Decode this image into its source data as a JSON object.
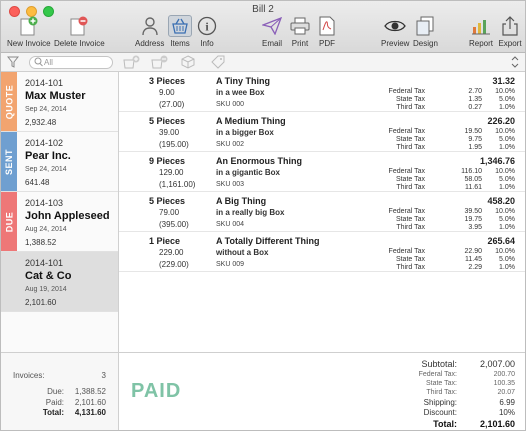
{
  "window": {
    "title": "Bill 2"
  },
  "toolbar": {
    "new_invoice": "New Invoice",
    "delete_invoice": "Delete Invoice",
    "address": "Address",
    "items": "Items",
    "info": "Info",
    "email": "Email",
    "print": "Print",
    "pdf": "PDF",
    "preview": "Preview",
    "design": "Design",
    "report": "Report",
    "export": "Export"
  },
  "search": {
    "placeholder": "All"
  },
  "invoices": [
    {
      "status": "QUOTE",
      "status_color": "#f2a46f",
      "number": "2014-101",
      "client": "Max Muster",
      "date": "Sep 24, 2014",
      "amount": "2,932.48"
    },
    {
      "status": "SENT",
      "status_color": "#6f9fd0",
      "number": "2014-102",
      "client": "Pear Inc.",
      "date": "Sep 24, 2014",
      "amount": "641.48"
    },
    {
      "status": "DUE",
      "status_color": "#ee7777",
      "number": "2014-103",
      "client": "John Appleseed",
      "date": "Aug 24, 2014",
      "amount": "1,388.52"
    },
    {
      "status": "",
      "status_color": "",
      "number": "2014-101",
      "client": "Cat & Co",
      "date": "Aug 19, 2014",
      "amount": "2,101.60"
    }
  ],
  "left_summary": {
    "invoices_label": "Invoices:",
    "invoices_value": "3",
    "due_label": "Due:",
    "due_value": "1,388.52",
    "paid_label": "Paid:",
    "paid_value": "2,101.60",
    "total_label": "Total:",
    "total_value": "4,131.60"
  },
  "items": [
    {
      "qty": "3 Pieces",
      "price": "9.00",
      "line_total": "(27.00)",
      "name": "A Tiny Thing",
      "desc": "in a wee Box",
      "sku": "SKU 000",
      "total": "31.32",
      "taxes": [
        {
          "label": "Federal Tax",
          "amount": "2.70",
          "rate": "10.0%"
        },
        {
          "label": "State Tax",
          "amount": "1.35",
          "rate": "5.0%"
        },
        {
          "label": "Third Tax",
          "amount": "0.27",
          "rate": "1.0%"
        }
      ]
    },
    {
      "qty": "5 Pieces",
      "price": "39.00",
      "line_total": "(195.00)",
      "name": "A Medium Thing",
      "desc": "in a bigger Box",
      "sku": "SKU 002",
      "total": "226.20",
      "taxes": [
        {
          "label": "Federal Tax",
          "amount": "19.50",
          "rate": "10.0%"
        },
        {
          "label": "State Tax",
          "amount": "9.75",
          "rate": "5.0%"
        },
        {
          "label": "Third Tax",
          "amount": "1.95",
          "rate": "1.0%"
        }
      ]
    },
    {
      "qty": "9 Pieces",
      "price": "129.00",
      "line_total": "(1,161.00)",
      "name": "An Enormous Thing",
      "desc": "in a gigantic Box",
      "sku": "SKU 003",
      "total": "1,346.76",
      "taxes": [
        {
          "label": "Federal Tax",
          "amount": "116.10",
          "rate": "10.0%"
        },
        {
          "label": "State Tax",
          "amount": "58.05",
          "rate": "5.0%"
        },
        {
          "label": "Third Tax",
          "amount": "11.61",
          "rate": "1.0%"
        }
      ]
    },
    {
      "qty": "5 Pieces",
      "price": "79.00",
      "line_total": "(395.00)",
      "name": "A Big Thing",
      "desc": "in a really big Box",
      "sku": "SKU 004",
      "total": "458.20",
      "taxes": [
        {
          "label": "Federal Tax",
          "amount": "39.50",
          "rate": "10.0%"
        },
        {
          "label": "State Tax",
          "amount": "19.75",
          "rate": "5.0%"
        },
        {
          "label": "Third Tax",
          "amount": "3.95",
          "rate": "1.0%"
        }
      ]
    },
    {
      "qty": "1 Piece",
      "price": "229.00",
      "line_total": "(229.00)",
      "name": "A Totally Different Thing",
      "desc": "without a Box",
      "sku": "SKU 009",
      "total": "265.64",
      "taxes": [
        {
          "label": "Federal Tax",
          "amount": "22.90",
          "rate": "10.0%"
        },
        {
          "label": "State Tax",
          "amount": "11.45",
          "rate": "5.0%"
        },
        {
          "label": "Third Tax",
          "amount": "2.29",
          "rate": "1.0%"
        }
      ]
    }
  ],
  "summary": {
    "status": "PAID",
    "subtotal_label": "Subtotal:",
    "subtotal": "2,007.00",
    "federal_label": "Federal Tax:",
    "federal": "200.70",
    "state_label": "State Tax:",
    "state": "100.35",
    "third_label": "Third Tax:",
    "third": "20.07",
    "shipping_label": "Shipping:",
    "shipping": "6.99",
    "discount_label": "Discount:",
    "discount": "10%",
    "total_label": "Total:",
    "total": "2,101.60"
  }
}
